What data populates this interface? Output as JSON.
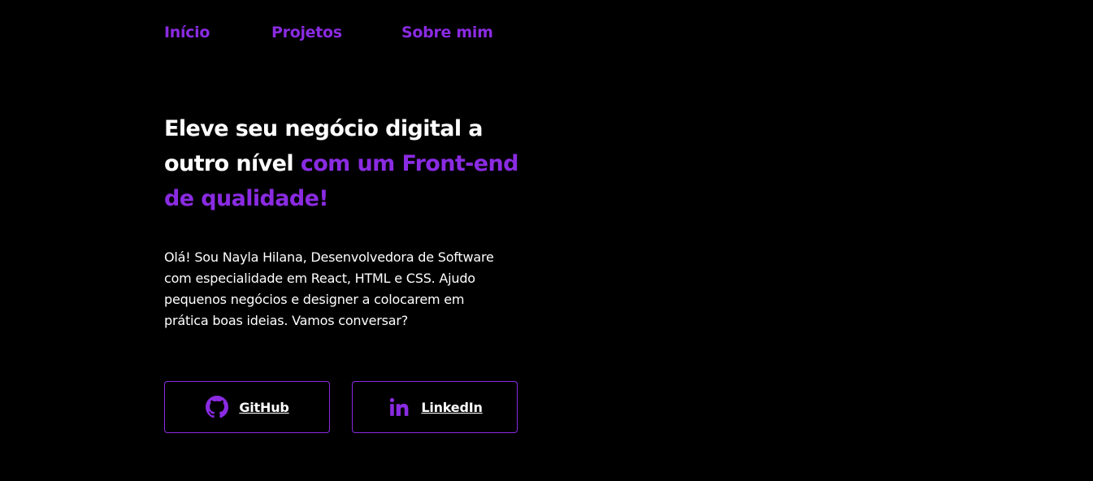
{
  "nav": {
    "items": [
      {
        "label": "Início"
      },
      {
        "label": "Projetos"
      },
      {
        "label": "Sobre mim"
      }
    ]
  },
  "hero": {
    "title_plain": "Eleve seu negócio digital a outro nível",
    "title_accent": "com um Front-end de qualidade!",
    "description": "Olá! Sou Nayla Hilana, Desenvolvedora de Software com especialidade em React, HTML e CSS. Ajudo pequenos negócios e designer a colocarem em prática boas ideias. Vamos conversar?"
  },
  "social": {
    "github": {
      "label": "GitHub",
      "icon": "github-icon"
    },
    "linkedin": {
      "label": "LinkedIn",
      "icon": "linkedin-icon"
    }
  },
  "colors": {
    "background": "#000000",
    "accent": "#8a2be2",
    "text": "#ffffff"
  }
}
